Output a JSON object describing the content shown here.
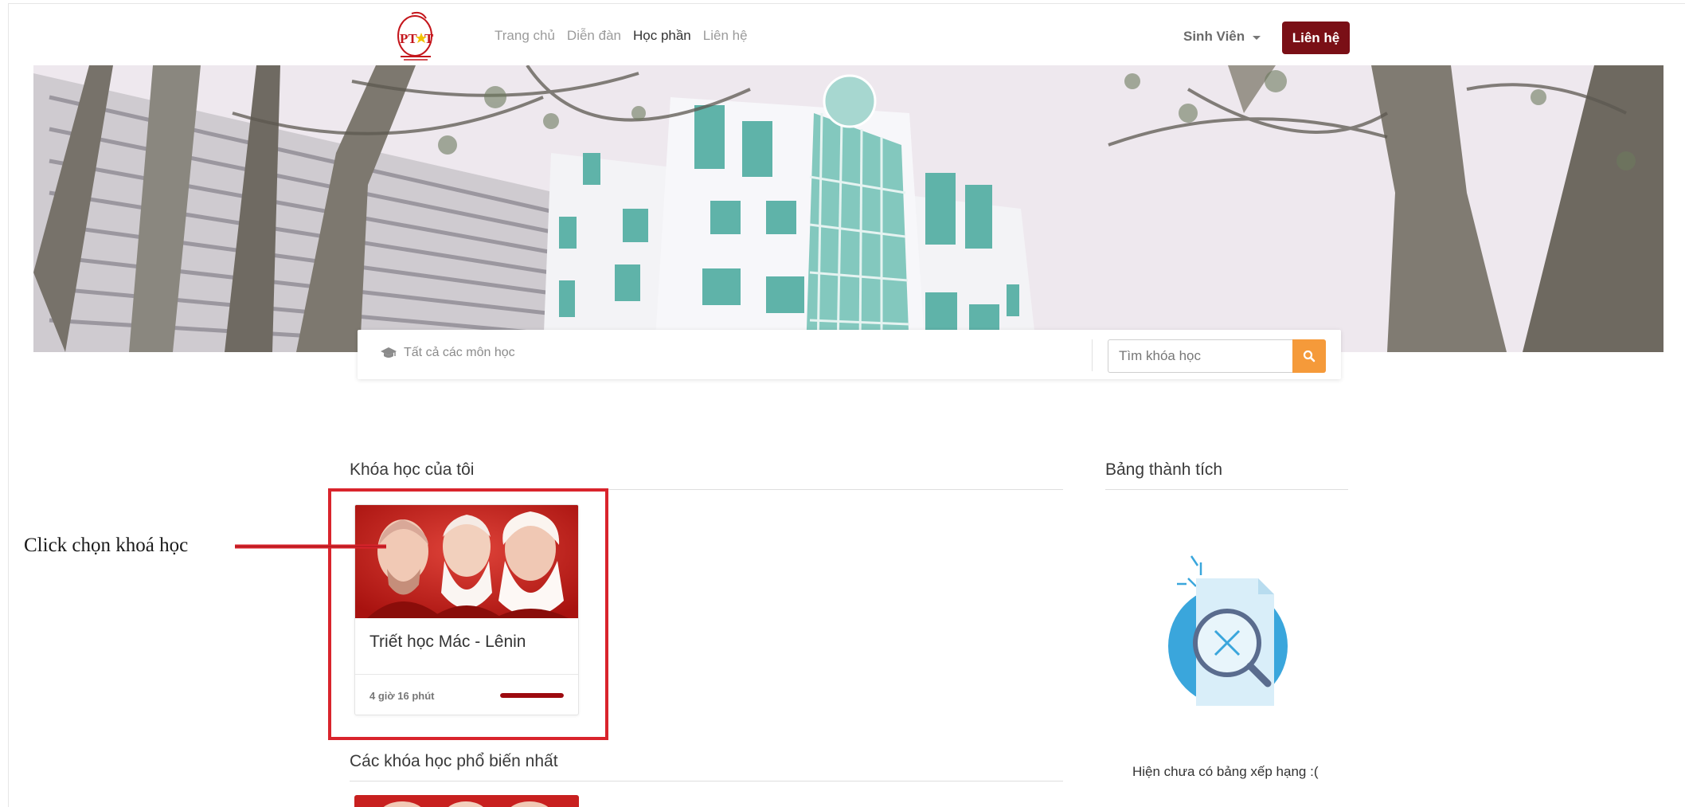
{
  "navbar": {
    "logo": {
      "text": "PTIT"
    },
    "links": [
      {
        "label": "Trang chủ",
        "active": false
      },
      {
        "label": "Diễn đàn",
        "active": false
      },
      {
        "label": "Học phần",
        "active": true
      },
      {
        "label": "Liên hệ",
        "active": false
      }
    ],
    "user_menu_label": "Sinh Viên",
    "contact_button": "Liên hệ"
  },
  "search": {
    "category_label": "Tất cả các môn học",
    "input_placeholder": "Tìm khóa học"
  },
  "my_courses": {
    "title": "Khóa học của tôi",
    "courses": [
      {
        "title": "Triết học Mác - Lênin",
        "duration": "4 giờ 16 phút",
        "progress": 1.0
      }
    ]
  },
  "popular_courses": {
    "title": "Các khóa học phổ biến nhất"
  },
  "leaderboard": {
    "title": "Bảng thành tích",
    "empty_message": "Hiện chưa có bảng xếp hạng :("
  },
  "annotation": {
    "text": "Click chọn khoá học"
  },
  "colors": {
    "brand": "#7a0f16",
    "search_button": "#f59a3a",
    "highlight": "#d9242c",
    "progress": "#9d0a0f"
  }
}
